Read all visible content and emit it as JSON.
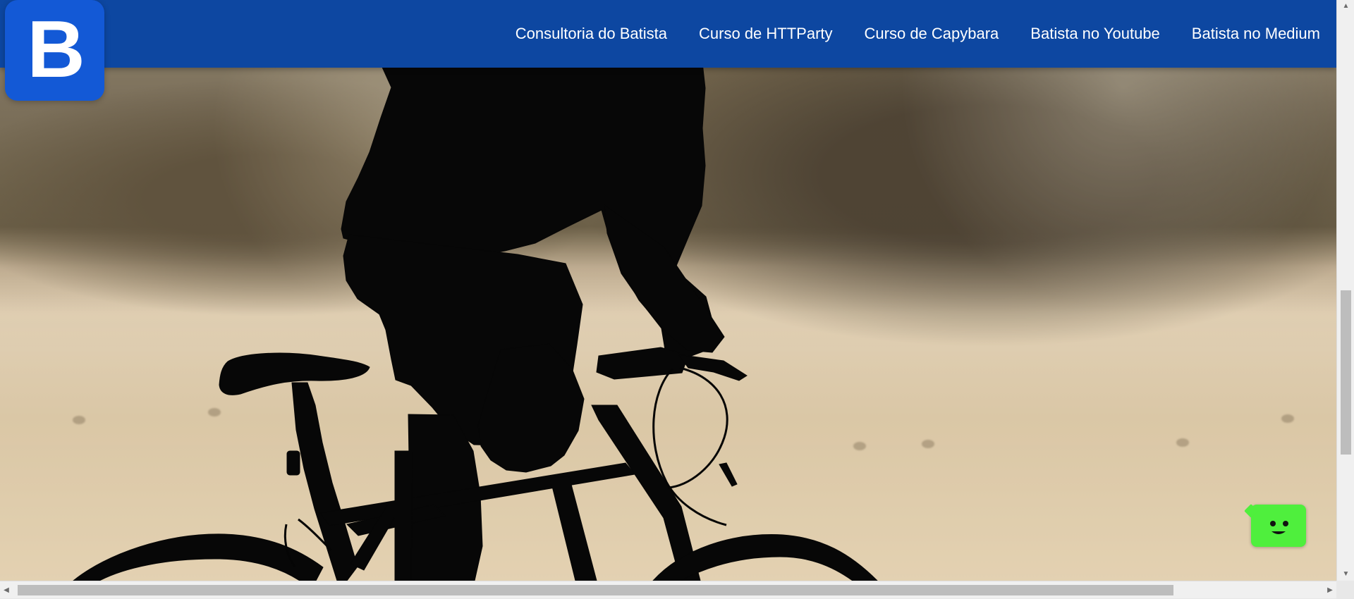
{
  "header": {
    "logo_text": "B",
    "nav": [
      "Consultoria do Batista",
      "Curso de HTTParty",
      "Curso de Capybara",
      "Batista no Youtube",
      "Batista no Medium"
    ]
  },
  "icons": {
    "logo": "logo-b-icon",
    "chat": "chat-smile-icon",
    "scroll_up": "chevron-up-icon",
    "scroll_down": "chevron-down-icon",
    "scroll_left": "chevron-left-icon",
    "scroll_right": "chevron-right-icon"
  },
  "colors": {
    "header_bg": "#0d47a1",
    "logo_bg": "#1359d6",
    "nav_text": "#ffffff",
    "chat_bg": "#4fef3d"
  }
}
